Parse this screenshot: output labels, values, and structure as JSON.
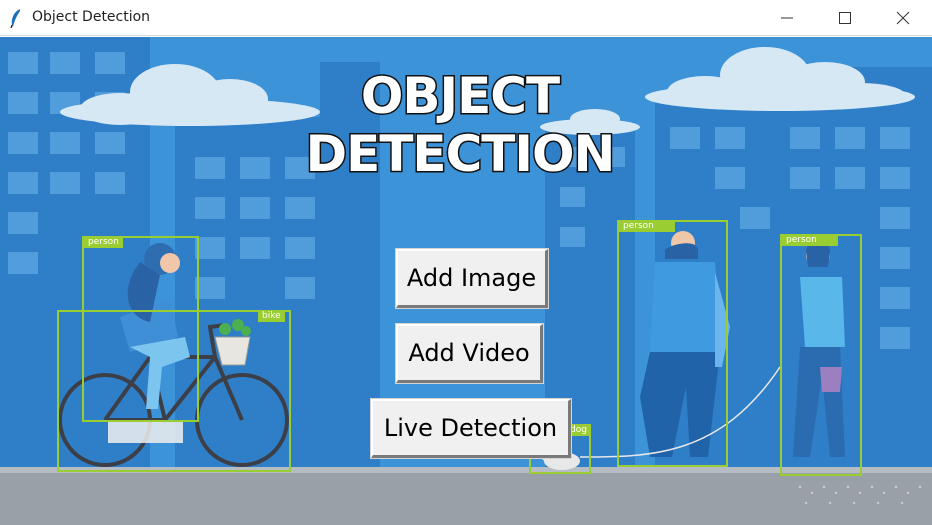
{
  "window": {
    "title": "Object Detection",
    "controls": [
      "minimize",
      "maximize",
      "close"
    ],
    "icon": "feather-icon"
  },
  "app": {
    "title_line1": "OBJECT",
    "title_line2": "DETECTION"
  },
  "buttons": {
    "add_image": "Add Image",
    "add_video": "Add Video",
    "live_detection": "Live Detection"
  },
  "detections": {
    "person_cyclist": "person",
    "bike": "bike",
    "person_man": "person",
    "person_woman": "person",
    "dog": "dog"
  },
  "colors": {
    "sky": "#3a8fd6",
    "buildings": "#2f7cc6",
    "box": "#9acd32",
    "button_bg": "#f0f0f0"
  }
}
